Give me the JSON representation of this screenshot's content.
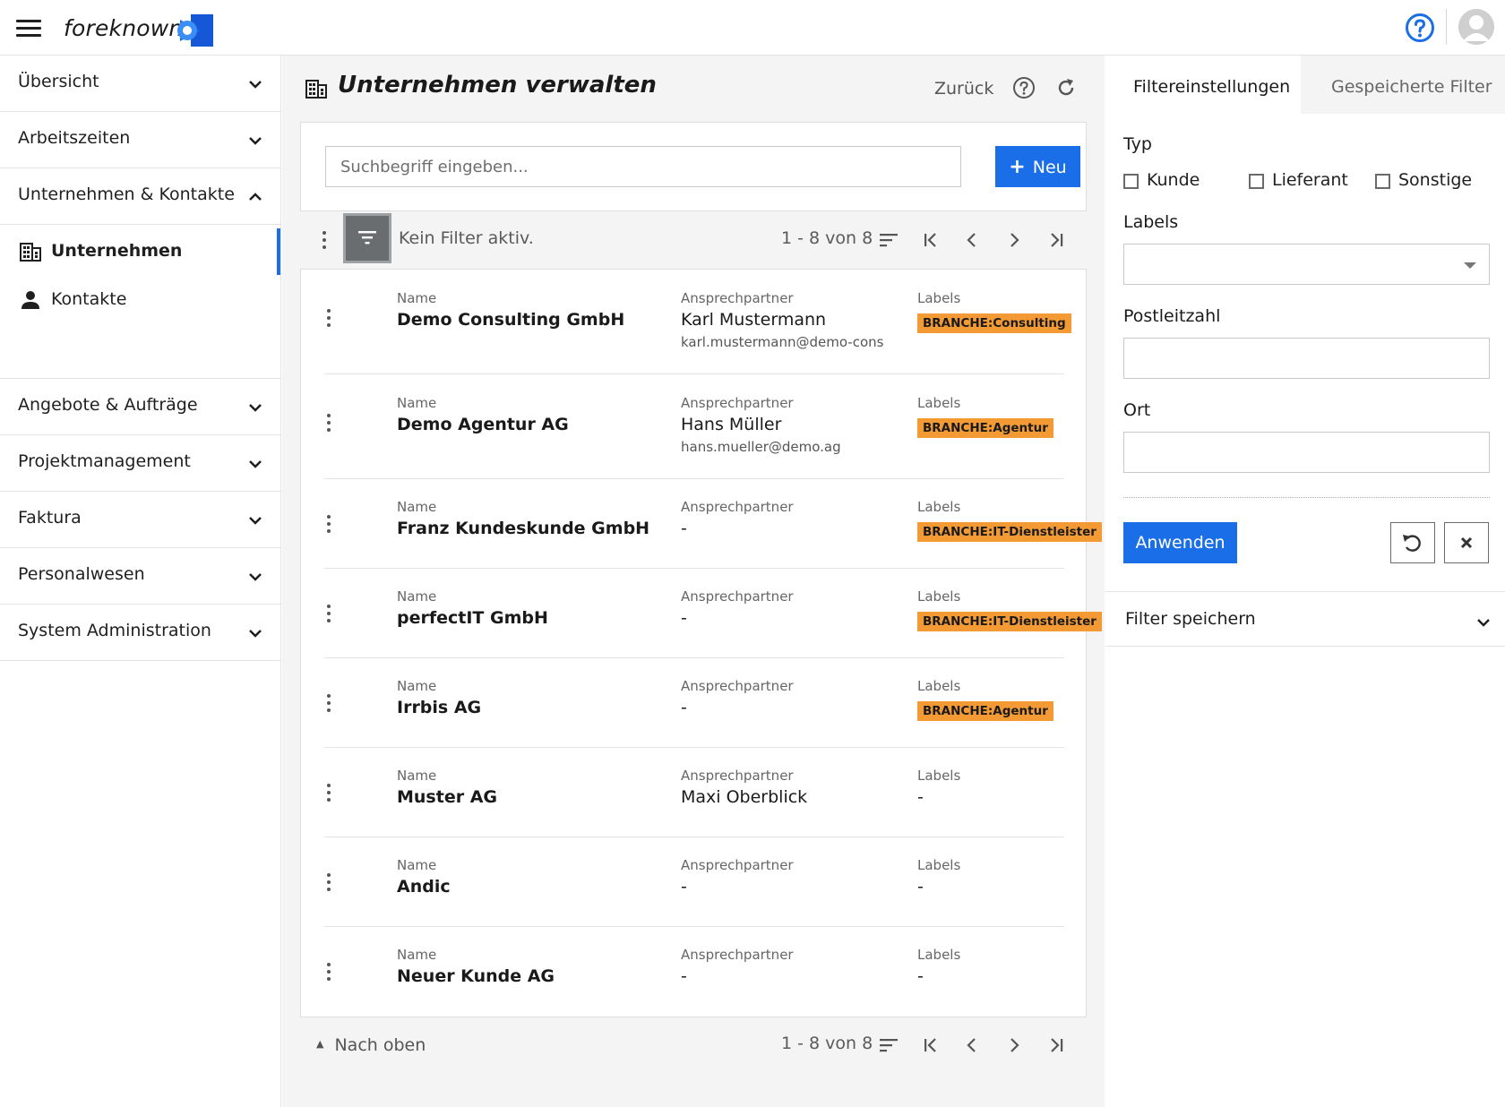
{
  "app": {
    "logo_text": "foreknown"
  },
  "sidebar": {
    "sections": [
      {
        "label": "Übersicht"
      },
      {
        "label": "Arbeitszeiten"
      },
      {
        "label": "Unternehmen & Kontakte",
        "expanded": true
      },
      {
        "label": "Angebote & Aufträge"
      },
      {
        "label": "Projektmanagement"
      },
      {
        "label": "Faktura"
      },
      {
        "label": "Personalwesen"
      },
      {
        "label": "System Administration"
      }
    ],
    "sub_items": [
      {
        "label": "Unternehmen",
        "icon": "building-icon",
        "active": true
      },
      {
        "label": "Kontakte",
        "icon": "person-icon"
      }
    ]
  },
  "main": {
    "title": "Unternehmen verwalten",
    "back_label": "Zurück",
    "search": {
      "placeholder": "Suchbegriff eingeben...",
      "value": ""
    },
    "new_button": "Neu",
    "filter_status": "Kein Filter aktiv.",
    "page_info_top": "1 - 8 von 8",
    "page_info_bottom": "1 - 8 von 8",
    "to_top_label": "Nach oben",
    "col_labels": {
      "name": "Name",
      "contact": "Ansprechpartner",
      "labels": "Labels"
    },
    "rows": [
      {
        "name": "Demo Consulting GmbH",
        "contact": "Karl Mustermann",
        "email": "karl.mustermann@demo-consult",
        "label": "BRANCHE:Consulting"
      },
      {
        "name": "Demo Agentur AG",
        "contact": "Hans Müller",
        "email": "hans.mueller@demo.ag",
        "label": "BRANCHE:Agentur"
      },
      {
        "name": "Franz Kundeskunde GmbH",
        "contact": "-",
        "email": "",
        "label": "BRANCHE:IT-Dienstleister"
      },
      {
        "name": "perfectIT GmbH",
        "contact": "-",
        "email": "",
        "label": "BRANCHE:IT-Dienstleister"
      },
      {
        "name": "Irrbis AG",
        "contact": "-",
        "email": "",
        "label": "BRANCHE:Agentur"
      },
      {
        "name": "Muster AG",
        "contact": "Maxi Oberblick",
        "email": "",
        "label": "-"
      },
      {
        "name": "Andic",
        "contact": "-",
        "email": "",
        "label": "-"
      },
      {
        "name": "Neuer Kunde AG",
        "contact": "-",
        "email": "",
        "label": "-"
      }
    ]
  },
  "filter_panel": {
    "tab_active": "Filtereinstellungen",
    "tab_inactive": "Gespeicherte Filter",
    "typ_label": "Typ",
    "checkboxes": [
      "Kunde",
      "Lieferant",
      "Sonstige"
    ],
    "labels_label": "Labels",
    "plz_label": "Postleitzahl",
    "ort_label": "Ort",
    "apply_button": "Anwenden",
    "save_filter_label": "Filter speichern"
  },
  "colors": {
    "accent": "#1a6fe8",
    "badge": "#f39a35",
    "filter_button": "#6a6d70"
  }
}
